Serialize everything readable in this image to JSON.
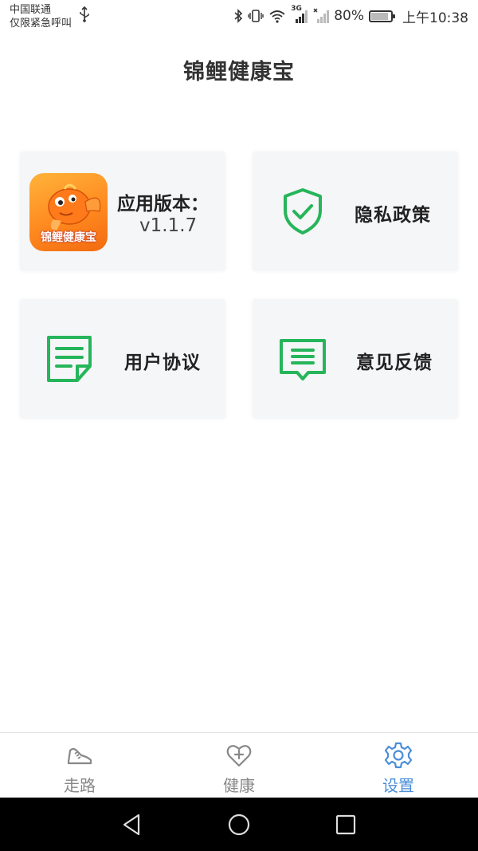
{
  "status_bar": {
    "carrier_line1": "中国联通",
    "carrier_line2": "仅限紧急呼叫",
    "network": "3G",
    "battery": "80%",
    "time": "上午10:38"
  },
  "header": {
    "title": "锦鲤健康宝"
  },
  "cards": {
    "version": {
      "logo_text": "锦鲤健康宝",
      "label": "应用版本：",
      "value": "v1.1.7"
    },
    "privacy": {
      "label": "隐私政策",
      "icon": "shield-check-icon"
    },
    "terms": {
      "label": "用户协议",
      "icon": "document-icon"
    },
    "feedback": {
      "label": "意见反馈",
      "icon": "message-icon"
    }
  },
  "bottom_nav": {
    "items": [
      {
        "label": "走路",
        "icon": "shoe-icon",
        "active": false
      },
      {
        "label": "健康",
        "icon": "heart-plus-icon",
        "active": false
      },
      {
        "label": "设置",
        "icon": "gear-icon",
        "active": true
      }
    ]
  },
  "colors": {
    "accent_green": "#26b55a",
    "active_blue": "#4a8ed8",
    "inactive_gray": "#888888",
    "card_background": "#f5f6f8"
  }
}
